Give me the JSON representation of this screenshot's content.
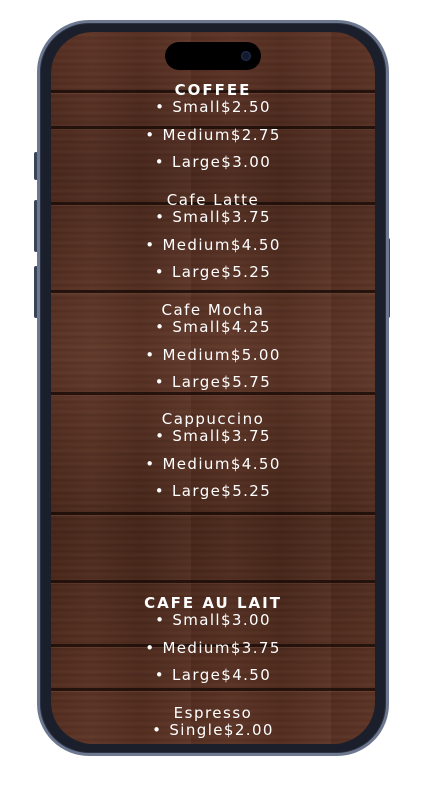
{
  "menu": {
    "sections": [
      {
        "title": "COFFEE",
        "items": [
          {
            "label": "Small$2.50"
          },
          {
            "label": "Medium$2.75"
          },
          {
            "label": "Large$3.00"
          }
        ]
      },
      {
        "title": "Cafe Latte",
        "items": [
          {
            "label": "Small$3.75"
          },
          {
            "label": "Medium$4.50"
          },
          {
            "label": "Large$5.25"
          }
        ]
      },
      {
        "title": "Cafe Mocha",
        "items": [
          {
            "label": "Small$4.25"
          },
          {
            "label": "Medium$5.00"
          },
          {
            "label": "Large$5.75"
          }
        ]
      },
      {
        "title": "Cappuccino",
        "items": [
          {
            "label": "Small$3.75"
          },
          {
            "label": "Medium$4.50"
          },
          {
            "label": "Large$5.25"
          }
        ]
      },
      {
        "title": "CAFE AU LAIT",
        "items": [
          {
            "label": "Small$3.00"
          },
          {
            "label": "Medium$3.75"
          },
          {
            "label": "Large$4.50"
          }
        ]
      },
      {
        "title": "Espresso",
        "items": [
          {
            "label": "Single$2.00"
          }
        ]
      }
    ],
    "bullet": "•"
  },
  "colors": {
    "text": "#ffffff",
    "wood": "#5b3123",
    "frame": "#6d7890"
  },
  "icons": {
    "camera": "front-camera-icon"
  }
}
